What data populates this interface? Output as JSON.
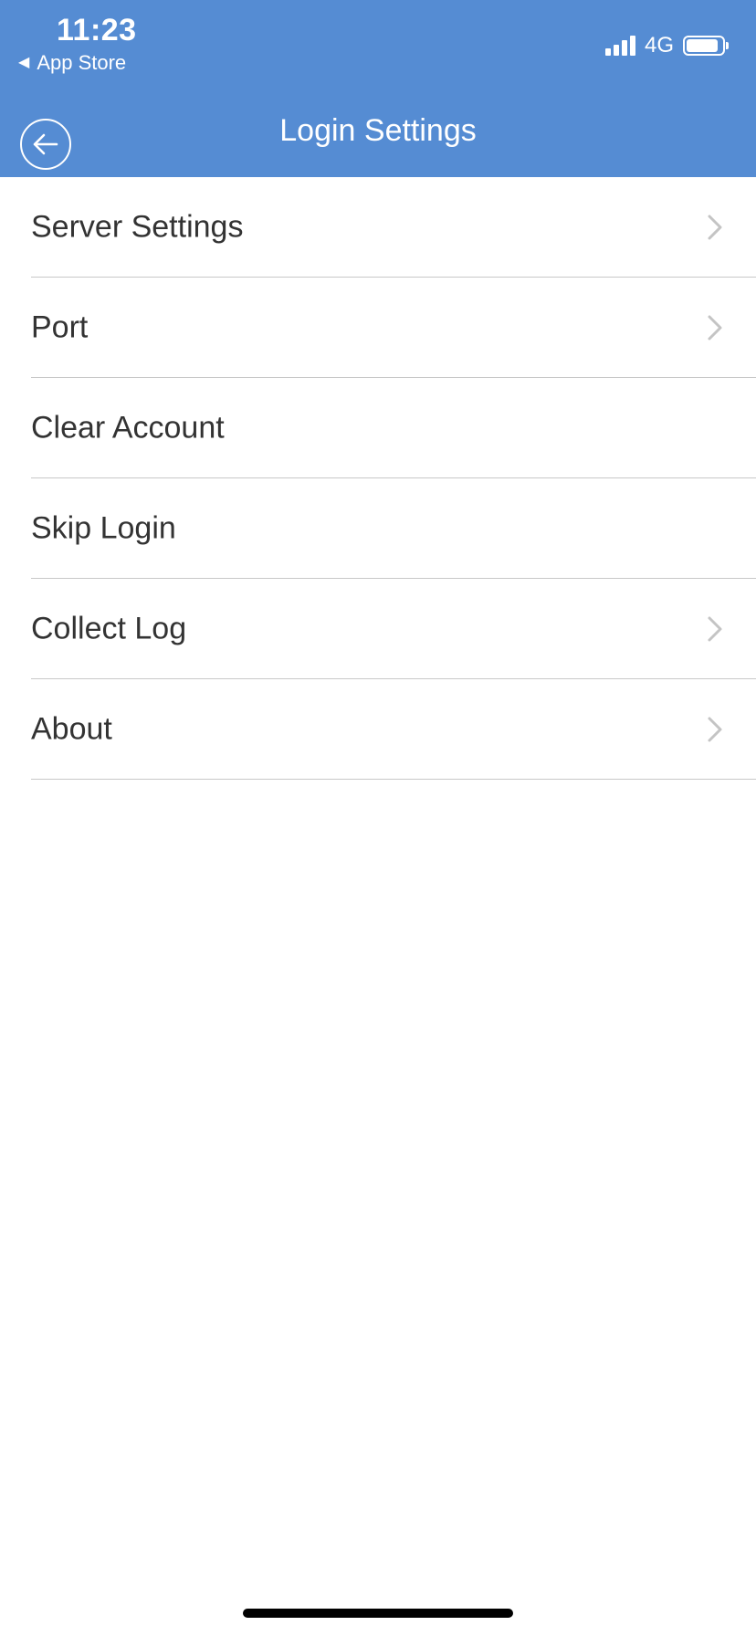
{
  "status_bar": {
    "time": "11:23",
    "back_app": "App Store",
    "network": "4G"
  },
  "header": {
    "title": "Login Settings"
  },
  "settings": {
    "items": [
      {
        "label": "Server Settings",
        "has_chevron": true
      },
      {
        "label": "Port",
        "has_chevron": true
      },
      {
        "label": "Clear Account",
        "has_chevron": false
      },
      {
        "label": "Skip Login",
        "has_chevron": false
      },
      {
        "label": "Collect Log",
        "has_chevron": true
      },
      {
        "label": "About",
        "has_chevron": true
      }
    ]
  },
  "colors": {
    "header_bg": "#558cd3",
    "text": "#333333",
    "divider": "#c8c8c8",
    "chevron": "#c4c4c4"
  }
}
